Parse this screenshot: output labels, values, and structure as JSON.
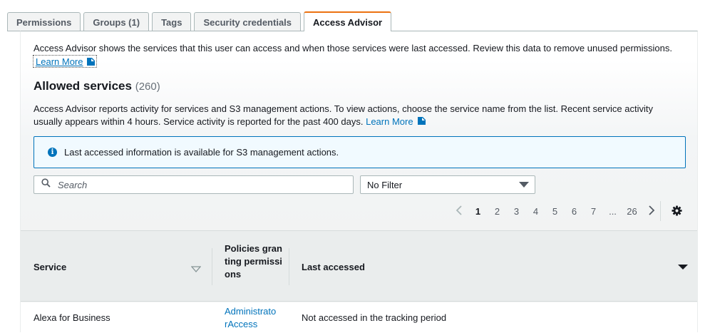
{
  "tabs": [
    {
      "label": "Permissions"
    },
    {
      "label": "Groups (1)"
    },
    {
      "label": "Tags"
    },
    {
      "label": "Security credentials"
    },
    {
      "label": "Access Advisor"
    }
  ],
  "active_tab": "Access Advisor",
  "intro": {
    "text": "Access Advisor shows the services that this user can access and when those services were last accessed. Review this data to remove unused permissions.",
    "learn_more": "Learn More"
  },
  "allowed_services": {
    "title": "Allowed services",
    "count": "(260)",
    "description": "Access Advisor reports activity for services and S3 management actions. To view actions, choose the service name from the list. Recent service activity usually appears within 4 hours. Service activity is reported for the past 400 days.",
    "learn_more": "Learn More"
  },
  "alert": {
    "text": "Last accessed information is available for S3 management actions."
  },
  "search": {
    "placeholder": "Search",
    "value": ""
  },
  "filter": {
    "selected": "No Filter"
  },
  "pagination": {
    "prev": "‹",
    "pages": [
      "1",
      "2",
      "3",
      "4",
      "5",
      "6",
      "7",
      "...",
      "26"
    ],
    "current": "1",
    "next": "›"
  },
  "table": {
    "headers": {
      "service": "Service",
      "policies": "Policies granting permissions",
      "last_accessed": "Last accessed"
    },
    "rows": [
      {
        "service": "Alexa for Business",
        "policies": "AdministratorAccess",
        "last_accessed": "Not accessed in the tracking period"
      }
    ]
  },
  "icons": {
    "external_link": "external-link-icon",
    "info": "info-icon",
    "search": "search-icon",
    "dropdown": "caret-down-icon",
    "settings": "gear-icon"
  },
  "colors": {
    "accent_tab": "#ec7211",
    "link": "#0073bb",
    "alert_border": "#0073bb",
    "alert_bg": "#f1faff"
  }
}
